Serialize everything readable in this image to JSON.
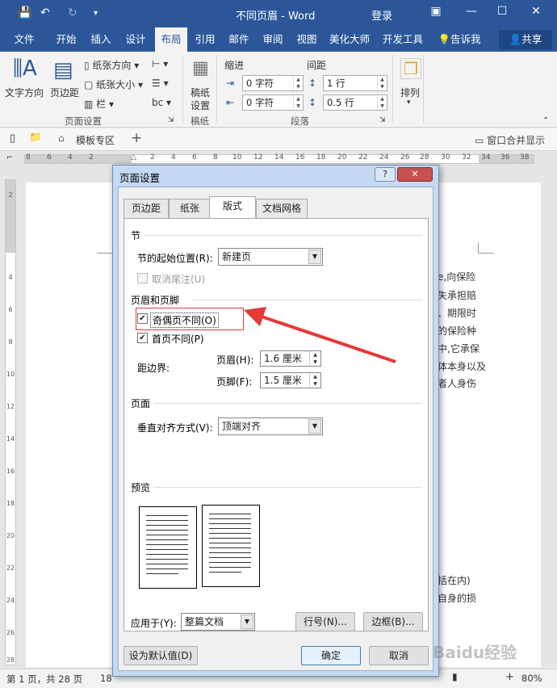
{
  "window": {
    "title": "不同页眉 - Word",
    "user": "登录"
  },
  "tabs": [
    {
      "label": "文件"
    },
    {
      "label": "开始"
    },
    {
      "label": "插入"
    },
    {
      "label": "设计"
    },
    {
      "label": "布局"
    },
    {
      "label": "引用"
    },
    {
      "label": "邮件"
    },
    {
      "label": "审阅"
    },
    {
      "label": "视图"
    },
    {
      "label": "美化大师"
    },
    {
      "label": "开发工具"
    }
  ],
  "tell_me": "告诉我",
  "share": "共享",
  "ribbon": {
    "text_direction": "文字方向",
    "margins": "页边距",
    "orientation": "纸张方向",
    "size": "纸张大小",
    "columns": "栏",
    "page_setup_group": "页面设置",
    "manuscript": "稿纸",
    "manuscript2": "设置",
    "manuscript_group": "稿纸",
    "indent": "缩进",
    "spacing": "间距",
    "indent_left": "0 字符",
    "indent_right": "0 字符",
    "spacing_before": "1 行",
    "spacing_after": "0.5 行",
    "paragraph_group": "段落",
    "arrange": "排列"
  },
  "docbar": {
    "template_zone": "模板专区",
    "plus": "+",
    "merge": "窗口合并显示"
  },
  "ruler": [
    "8",
    "6",
    "4",
    "2",
    "2",
    "4",
    "6",
    "8",
    "10",
    "12",
    "14",
    "16",
    "18",
    "20",
    "22",
    "24",
    "26",
    "28",
    "30",
    "32",
    "34",
    "36",
    "38"
  ],
  "vruler": [
    "2",
    "4",
    "6",
    "8",
    "10",
    "12",
    "14",
    "16",
    "18",
    "20",
    "22",
    "24",
    "26",
    "28"
  ],
  "doc_text": [
    "e,向保险",
    "失承担赔",
    "、期限时",
    "的保险种",
    "中,它承保",
    "体本身以及",
    "者人身伤",
    "括在内)",
    "自身的损"
  ],
  "status": {
    "page": "第 1 页，共 28 页",
    "words": "18",
    "zoom": "80%"
  },
  "dialog": {
    "title": "页面设置",
    "help": "?",
    "close": "✕",
    "tabs": [
      {
        "label": "页边距"
      },
      {
        "label": "纸张"
      },
      {
        "label": "版式"
      },
      {
        "label": "文档网格"
      }
    ],
    "section_title": "节",
    "section_start_label": "节的起始位置(R):",
    "section_start_value": "新建页",
    "suppress_endnotes": "取消尾注(U)",
    "header_footer_title": "页眉和页脚",
    "odd_even": "奇偶页不同(O)",
    "first_page": "首页不同(P)",
    "from_edge": "距边界:",
    "header_label": "页眉(H):",
    "header_value": "1.6 厘米",
    "footer_label": "页脚(F):",
    "footer_value": "1.5 厘米",
    "page_title": "页面",
    "valign_label": "垂直对齐方式(V):",
    "valign_value": "顶端对齐",
    "preview_title": "预览",
    "apply_label": "应用于(Y):",
    "apply_value": "整篇文档",
    "line_numbers": "行号(N)...",
    "borders": "边框(B)...",
    "set_default": "设为默认值(D)",
    "ok": "确定",
    "cancel": "取消"
  },
  "watermark": "Baidu经验",
  "colors": {
    "accent": "#2b579a",
    "highlight": "#e53935"
  }
}
